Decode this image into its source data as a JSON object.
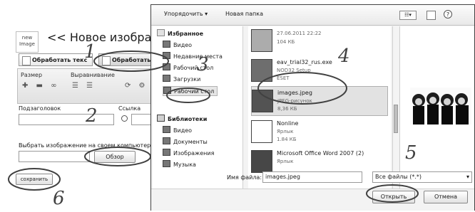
{
  "page": {
    "logo_line1": "new",
    "logo_line2": "Image",
    "title": "<< Новое изображ",
    "tab_process_text": "Обработать текс",
    "tab_process_image": "Обработать",
    "label_size": "Размер",
    "label_align": "Выравнивание",
    "label_subtitle": "Подзаголовок",
    "label_link": "Ссылка",
    "label_choose_image": "Выбрать изображение на своем компьютере",
    "browse_button": "Обзор",
    "save_button": "сохранить"
  },
  "dialog": {
    "toolbar": {
      "organize": "Упорядочить ▾",
      "new_folder": "Новая папка",
      "view_icon": "view-icon",
      "help_icon": "help-icon"
    },
    "nav": {
      "favorites_header": "Избранное",
      "favorites": [
        "Видео",
        "Недавние места",
        "Рабочий стол",
        "Загрузки",
        "Рабочий стол"
      ],
      "libraries_header": "Библиотеки",
      "libraries": [
        "Видео",
        "Документы",
        "Изображения",
        "Музыка"
      ]
    },
    "files": [
      {
        "name": "",
        "meta1": "27.06.2011 22:22",
        "meta2": "104 КБ"
      },
      {
        "name": "eav_trial32_rus.exe",
        "meta1": "NOD32 Setup",
        "meta2": "ESET"
      },
      {
        "name": "images.jpeg",
        "meta1": "JPEG-рисунок",
        "meta2": "8,36 КБ"
      },
      {
        "name": "Nonline",
        "meta1": "Ярлык",
        "meta2": "1.84 КБ"
      },
      {
        "name": "Microsoft Office Word 2007 (2)",
        "meta1": "Ярлык",
        "meta2": ""
      }
    ],
    "filename_label": "Имя файла:",
    "filename_value": "images.jpeg",
    "filetype_value": "Все файлы (*.*)",
    "open_button": "Открыть",
    "cancel_button": "Отмена"
  },
  "annotations": [
    "1",
    "2",
    "3",
    "4",
    "5",
    "6"
  ]
}
